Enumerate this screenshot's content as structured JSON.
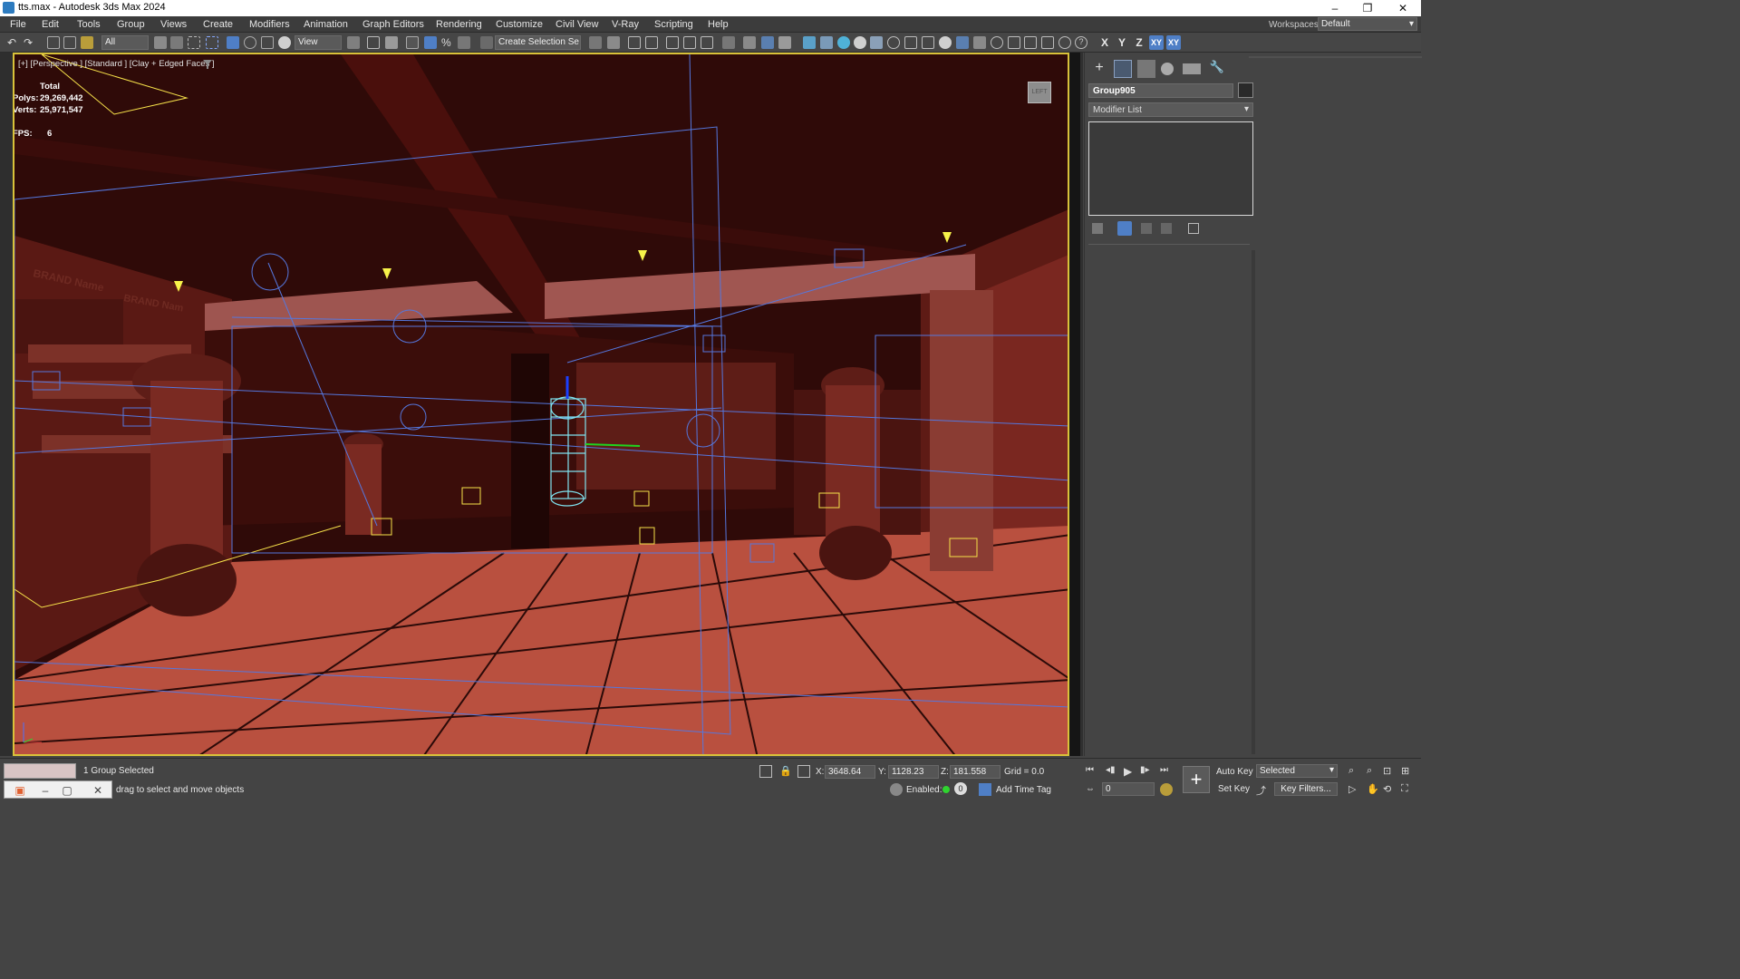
{
  "window": {
    "title": "tts.max - Autodesk 3ds Max 2024",
    "minimize": "–",
    "restore": "❐",
    "close": "✕"
  },
  "menu": {
    "items": [
      "File",
      "Edit",
      "Tools",
      "Group",
      "Views",
      "Create",
      "Modifiers",
      "Animation",
      "Graph Editors",
      "Rendering",
      "Customize",
      "Civil View",
      "V-Ray",
      "Scripting",
      "Help"
    ],
    "workspaces_label": "Workspaces:",
    "workspaces_value": "Default"
  },
  "toolbar": {
    "selection_filter": "All",
    "reference_coord": "View",
    "named_selection": "Create Selection Se",
    "axis_x": "X",
    "axis_y": "Y",
    "axis_z": "Z",
    "axis_xy": "XY",
    "axis_xy2": "XY"
  },
  "viewport": {
    "label": "[+] [Perspective ] [Standard ] [Clay + Edged Faces ]",
    "stats": {
      "total_label": "Total",
      "polys_label": "Polys:",
      "polys_value": "29,269,442",
      "verts_label": "Verts:",
      "verts_value": "25,971,547",
      "fps_label": "FPS:",
      "fps_value": "6"
    },
    "sign_text_1": "BRAND Name",
    "sign_text_2": "BRAND Nam",
    "viewcube_label": "LEFT"
  },
  "command_panel": {
    "object_name": "Group905",
    "modifier_list": "Modifier List"
  },
  "status": {
    "selection_count": "1 Group Selected",
    "prompt": "drag to select and move objects",
    "x_label": "X:",
    "x_value": "3648.64",
    "y_label": "Y:",
    "y_value": "1128.23",
    "z_label": "Z:",
    "z_value": "181.558",
    "grid": "Grid = 0.0",
    "enabled_label": "Enabled:",
    "enabled_value": "0",
    "add_time_tag": "Add Time Tag",
    "auto_key": "Auto Key",
    "set_key": "Set Key",
    "selected_option": "Selected",
    "key_filters": "Key Filters...",
    "frame_value": "0"
  },
  "colors": {
    "viewport_border": "#d9c23a",
    "floor": "#b9503f",
    "ceiling": "#3a0806",
    "wireframe_lights": "#5577dd",
    "selection_wire": "#7fe3f0",
    "accent_blue": "#4f7fc6"
  }
}
